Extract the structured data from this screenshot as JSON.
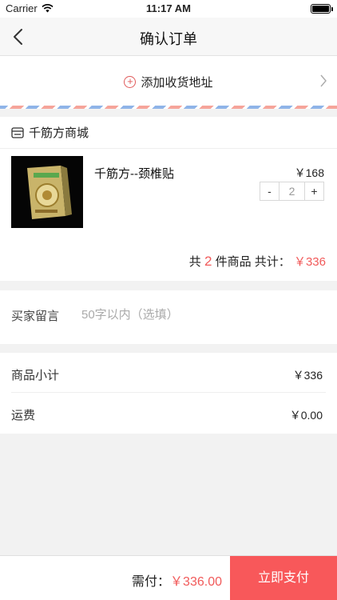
{
  "status_bar": {
    "carrier": "Carrier",
    "time": "11:17 AM"
  },
  "nav": {
    "title": "确认订单"
  },
  "address": {
    "add_label": "添加收货地址"
  },
  "shop": {
    "name": "千筋方商城",
    "product": {
      "name": "千筋方--颈椎贴",
      "price": "￥168",
      "quantity": "2"
    },
    "summary": {
      "prefix": "共",
      "count": "2",
      "middle": "件商品 共计：",
      "total": "￥336"
    }
  },
  "message": {
    "label": "买家留言",
    "placeholder": "50字以内（选填）"
  },
  "totals": {
    "subtotal_label": "商品小计",
    "subtotal_value": "￥336",
    "shipping_label": "运费",
    "shipping_value": "￥0.00"
  },
  "footer": {
    "due_label": "需付：",
    "due_amount": "￥336.00",
    "pay_button": "立即支付"
  },
  "colors": {
    "accent": "#f8585a",
    "price_red": "#f15a5a"
  },
  "icons": {
    "back": "chevron-left-icon",
    "add": "plus-circle-icon",
    "shop": "store-icon",
    "address_arrow": "chevron-right-icon"
  }
}
